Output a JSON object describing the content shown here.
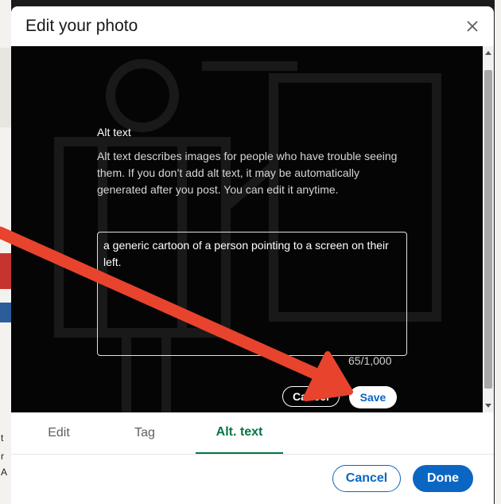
{
  "background_page": {
    "fragment_texts": [
      "t",
      "r",
      "A"
    ]
  },
  "modal": {
    "title": "Edit your photo"
  },
  "alt_text_panel": {
    "label": "Alt text",
    "description": "Alt text describes images for people who have trouble seeing them. If you don’t add alt text, it may be automatically generated after you post. You can edit it anytime.",
    "textarea_value": "a generic cartoon of a person pointing to a screen on their left.",
    "char_counter": "65/1,000",
    "cancel_label": "Cancel",
    "save_label": "Save"
  },
  "tabs": [
    {
      "label": "Edit",
      "active": false
    },
    {
      "label": "Tag",
      "active": false
    },
    {
      "label": "Alt. text",
      "active": true
    }
  ],
  "footer": {
    "cancel_label": "Cancel",
    "done_label": "Done"
  },
  "colors": {
    "primary_blue": "#0a66c2",
    "active_tab_green": "#057642",
    "annotation_arrow": "#e8432d"
  }
}
